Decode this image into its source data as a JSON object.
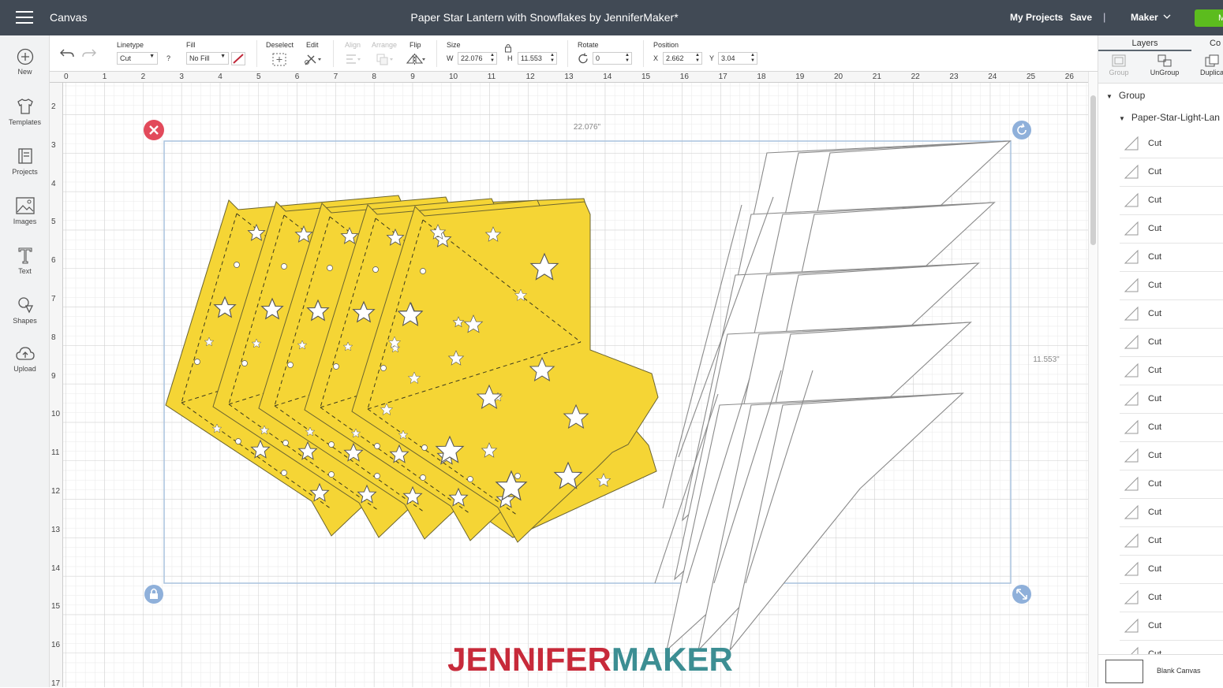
{
  "header": {
    "app_title": "Canvas",
    "doc_title": "Paper Star Lantern with Snowflakes by JenniferMaker*",
    "my_projects": "My Projects",
    "save": "Save",
    "separator": "|",
    "machine": "Maker",
    "make": "M"
  },
  "leftbar": {
    "items": [
      {
        "label": "New",
        "icon": "plus-circle-icon"
      },
      {
        "label": "Templates",
        "icon": "shirt-icon"
      },
      {
        "label": "Projects",
        "icon": "projects-icon"
      },
      {
        "label": "Images",
        "icon": "image-icon"
      },
      {
        "label": "Text",
        "icon": "text-icon"
      },
      {
        "label": "Shapes",
        "icon": "shapes-icon"
      },
      {
        "label": "Upload",
        "icon": "upload-cloud-icon"
      }
    ]
  },
  "toolbar": {
    "linetype_label": "Linetype",
    "linetype_value": "Cut",
    "help": "?",
    "fill_label": "Fill",
    "fill_value": "No Fill",
    "deselect_label": "Deselect",
    "edit_label": "Edit",
    "align_label": "Align",
    "arrange_label": "Arrange",
    "flip_label": "Flip",
    "size_label": "Size",
    "w_label": "W",
    "w_value": "22.076",
    "h_label": "H",
    "h_value": "11.553",
    "rotate_label": "Rotate",
    "rotate_value": "0",
    "position_label": "Position",
    "x_label": "X",
    "x_value": "2.662",
    "y_label": "Y",
    "y_value": "3.04"
  },
  "ruler": {
    "horizontal": [
      "0",
      "1",
      "2",
      "3",
      "4",
      "5",
      "6",
      "7",
      "8",
      "9",
      "10",
      "11",
      "12",
      "13",
      "14",
      "15",
      "16",
      "17",
      "18",
      "19",
      "20",
      "21",
      "22",
      "23",
      "24",
      "25",
      "26"
    ],
    "vertical": [
      "2",
      "3",
      "4",
      "5",
      "6",
      "7",
      "8",
      "9",
      "10",
      "11",
      "12",
      "13",
      "14",
      "15",
      "16",
      "17"
    ]
  },
  "canvas": {
    "width_dim": "22.076\"",
    "height_dim": "11.553\"",
    "watermark_left": "JENNIFER",
    "watermark_right": "MAKER",
    "colors": {
      "panel_fill": "#f5d535",
      "panel_stroke": "#6b6430",
      "bbox": "#a9c2dd",
      "delete_handle": "#e24a5b",
      "handle": "#8fb0da",
      "watermark_red": "#c72a3a",
      "watermark_teal": "#3c8e93"
    }
  },
  "rightpanel": {
    "tab_layers": "Layers",
    "tab_color": "Co",
    "actions": [
      {
        "label": "Group",
        "enabled": false
      },
      {
        "label": "UnGroup",
        "enabled": true
      },
      {
        "label": "Duplica",
        "enabled": true
      }
    ],
    "group_label": "Group",
    "subgroup_label": "Paper-Star-Light-Lan",
    "layers": [
      "Cut",
      "Cut",
      "Cut",
      "Cut",
      "Cut",
      "Cut",
      "Cut",
      "Cut",
      "Cut",
      "Cut",
      "Cut",
      "Cut",
      "Cut",
      "Cut",
      "Cut",
      "Cut",
      "Cut",
      "Cut",
      "Cut"
    ],
    "blank_canvas": "Blank Canvas"
  }
}
